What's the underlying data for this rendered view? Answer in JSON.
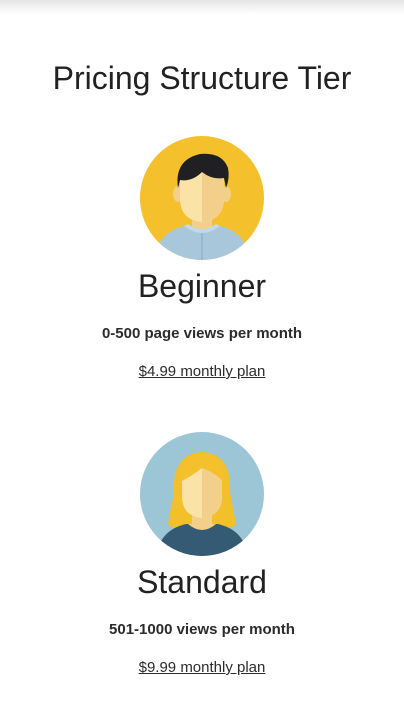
{
  "page": {
    "title": "Pricing Structure Tier"
  },
  "tiers": [
    {
      "name": "Beginner",
      "views": "0-500 page views per month",
      "price_link": "$4.99 monthly plan",
      "avatar": "male-user-avatar-icon",
      "avatar_bg": "#f4c02b"
    },
    {
      "name": "Standard",
      "views": "501-1000 views per month",
      "price_link": "$9.99 monthly plan",
      "avatar": "female-user-avatar-icon",
      "avatar_bg": "#9cc5d6"
    }
  ]
}
